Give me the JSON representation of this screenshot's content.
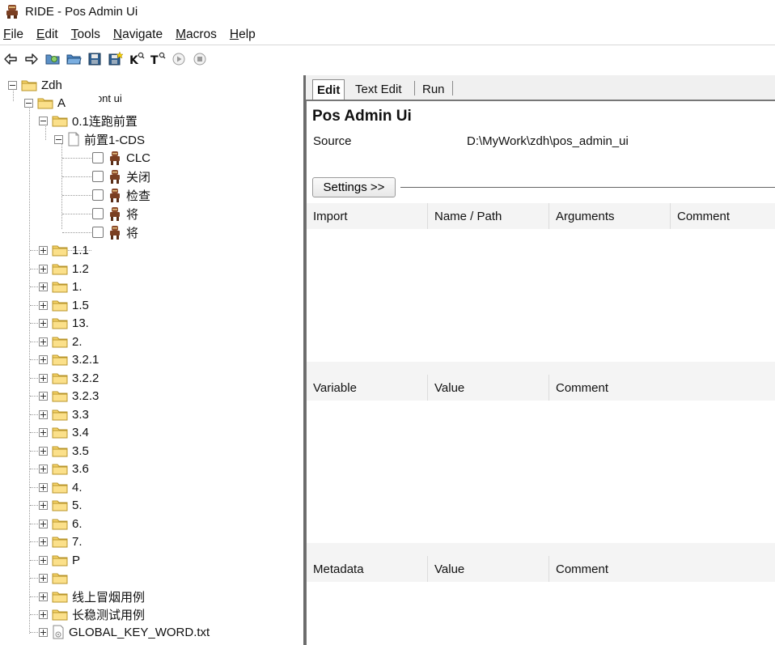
{
  "window": {
    "title": "RIDE - Pos Admin Ui"
  },
  "menu": [
    {
      "underline": "F",
      "rest": "ile"
    },
    {
      "underline": "E",
      "rest": "dit"
    },
    {
      "underline": "T",
      "rest": "ools"
    },
    {
      "underline": "N",
      "rest": "avigate"
    },
    {
      "underline": "M",
      "rest": "acros"
    },
    {
      "underline": "H",
      "rest": "elp"
    }
  ],
  "toolbar": {
    "icons": [
      "back-arrow-icon",
      "forward-arrow-icon",
      "open-directory-icon",
      "open-folder-icon",
      "save-icon",
      "save-all-icon",
      "search-keywords-icon",
      "search-tests-icon",
      "run-icon",
      "stop-icon"
    ]
  },
  "tree": {
    "root": "Zdh",
    "project": "A",
    "project_suffix": "front ui",
    "suite_01": "0.1连跑前置",
    "resource": "前置1-CDS",
    "tests": [
      "CLC",
      "关闭",
      "检查",
      "将",
      "将"
    ],
    "folders": [
      "1.1",
      "1.2",
      "1.",
      "1.5",
      "13.",
      "2.",
      "3.2.1",
      "3.2.2",
      "3.2.3",
      "3.3",
      "3.4",
      "3.5",
      "3.6",
      "4.",
      "5.",
      "6.",
      "7.",
      "P",
      "",
      "线上冒烟用例",
      "长稳测试用例"
    ],
    "file": "GLOBAL_KEY_WORD.txt"
  },
  "tabs": {
    "edit": "Edit",
    "text_edit": "Text Edit",
    "run": "Run"
  },
  "editor": {
    "title": "Pos Admin Ui",
    "source_label": "Source",
    "source_value": "D:\\MyWork\\zdh\\pos_admin_ui",
    "settings_button": "Settings >>",
    "import_table": {
      "headers": [
        "Import",
        "Name / Path",
        "Arguments",
        "Comment"
      ]
    },
    "variable_table": {
      "headers": [
        "Variable",
        "Value",
        "Comment"
      ]
    },
    "metadata_table": {
      "headers": [
        "Metadata",
        "Value",
        "Comment"
      ]
    }
  }
}
